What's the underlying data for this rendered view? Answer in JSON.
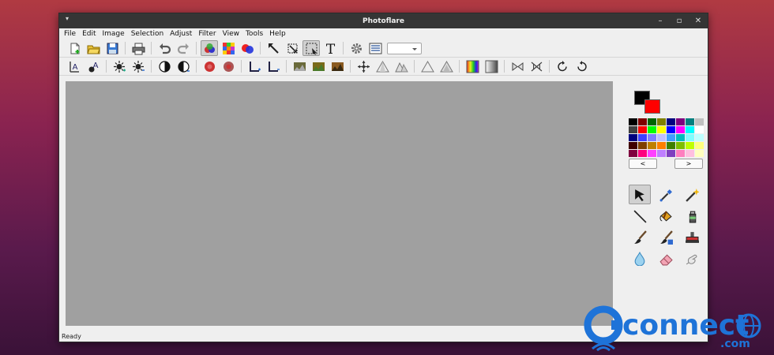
{
  "window": {
    "title": "Photoflare",
    "menu_glyph": "▾",
    "minimize": "–",
    "maximize": "▫",
    "close": "✕"
  },
  "menubar": [
    "File",
    "Edit",
    "Image",
    "Selection",
    "Adjust",
    "Filter",
    "View",
    "Tools",
    "Help"
  ],
  "toolbar1": [
    "new-document-icon",
    "open-folder-icon",
    "save-icon",
    "|",
    "print-icon",
    "|",
    "undo-icon",
    "redo-icon",
    "|",
    "color-picker-mode-icon",
    "pixelate-palette-icon",
    "color-circles-icon",
    "|",
    "pointer-arrow-icon",
    "crop-resize-icon",
    "marquee-select-icon",
    "text-tool-icon",
    "|",
    "settings-gear-icon",
    "preferences-list-icon",
    "zoom-combo"
  ],
  "toolbar2": [
    "flip-horizontal-icon",
    "flip-vertical-icon",
    "|",
    "brightness-up-icon",
    "brightness-down-icon",
    "|",
    "contrast-icon",
    "contrast-b-icon",
    "|",
    "saturation-up-icon",
    "saturation-down-icon",
    "|",
    "gamma-up-icon",
    "gamma-down-icon",
    "|",
    "auto-levels-icon",
    "auto-contrast-icon",
    "sepia-icon",
    "|",
    "move-drag-icon",
    "triangle-a-icon",
    "triangle-b-icon",
    "|",
    "triangle-c-icon",
    "triangle-d-icon",
    "|",
    "gradient-rainbow-icon",
    "gradient-grey-icon",
    "|",
    "flip-a-icon",
    "flip-b-icon",
    "|",
    "rotate-ccw-icon",
    "rotate-cw-icon"
  ],
  "colors": {
    "foreground": "#000000",
    "background": "#ff0000"
  },
  "palette": [
    "#000000",
    "#7f0000",
    "#006400",
    "#7f7f00",
    "#00007f",
    "#7f007f",
    "#007f7f",
    "#c0c0c0",
    "#404040",
    "#ff0000",
    "#00ff00",
    "#ffff00",
    "#0000ff",
    "#ff00ff",
    "#00ffff",
    "#ffffff",
    "#00007f",
    "#4040ff",
    "#7f7fff",
    "#bfbfff",
    "#3f9fff",
    "#00bfbf",
    "#7fffff",
    "#bfffff",
    "#3f0000",
    "#7f3f00",
    "#bf7f00",
    "#ff7f00",
    "#3f7f00",
    "#7fbf00",
    "#bfff00",
    "#ffff7f",
    "#7f003f",
    "#ff007f",
    "#ff3fff",
    "#bf7fff",
    "#7f3fbf",
    "#ff7fbf",
    "#ffbfdf",
    "#ffffbf"
  ],
  "palette_prev": "<",
  "palette_next": ">",
  "tools": [
    "pointer-icon",
    "eyedropper-icon",
    "magic-wand-icon",
    "line-icon",
    "paint-bucket-icon",
    "spray-can-icon",
    "paintbrush-icon",
    "smart-brush-icon",
    "stamp-icon",
    "blur-drop-icon",
    "eraser-icon",
    "smudge-icon"
  ],
  "status": "Ready",
  "watermark": {
    "text": "connect",
    "subtext": ".com"
  }
}
